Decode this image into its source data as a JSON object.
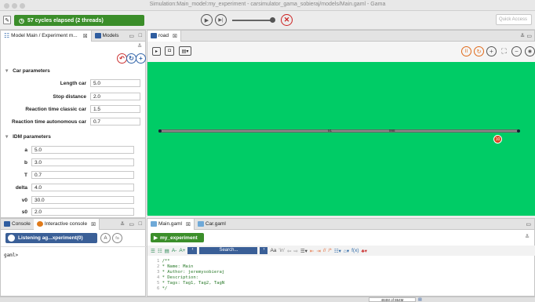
{
  "window": {
    "title": "Simulation:Main_model:my_experiment - carsimulator_gama_sobieraj/models/Main.gaml - Gama"
  },
  "toolbar": {
    "status": "57 cycles elapsed (2 threads)",
    "quick_access": "Quick Access"
  },
  "params_panel": {
    "tabs": [
      {
        "label": "Model Main / Experiment m..."
      },
      {
        "label": "Models"
      }
    ],
    "sections": {
      "car": "Car parameters",
      "idm": "IDM parameters"
    },
    "car_params": [
      {
        "label": "Length car",
        "value": "5.0"
      },
      {
        "label": "Stop distance",
        "value": "2.0"
      },
      {
        "label": "Reaction time classic car",
        "value": "1.5"
      },
      {
        "label": "Reaction time autonomous car",
        "value": "0.7"
      }
    ],
    "idm_params": [
      {
        "label": "a",
        "value": "5.0"
      },
      {
        "label": "b",
        "value": "3.0"
      },
      {
        "label": "T",
        "value": "0.7"
      },
      {
        "label": "delta",
        "value": "4.0"
      },
      {
        "label": "v0",
        "value": "30.0"
      },
      {
        "label": "s0",
        "value": "2.0"
      }
    ]
  },
  "display": {
    "tab": "road",
    "road_labels": [
      "91",
      "998"
    ],
    "car_marker": "10"
  },
  "console": {
    "tabs": [
      {
        "label": "Console"
      },
      {
        "label": "Interactive console"
      }
    ],
    "listening": "Listening ag...xperiment(0)",
    "btn_a": "A",
    "btn_fa": "fa",
    "prompt": "gaml>"
  },
  "editor": {
    "tabs": [
      {
        "label": "Main.gaml"
      },
      {
        "label": "Car.gaml"
      }
    ],
    "experiment_btn": "my_experiment",
    "search_placeholder": "Search...",
    "aa": "Aa",
    "in": "'in'",
    "comment": "//",
    "block": "/*",
    "fx": "f(x)",
    "code": [
      {
        "num": "1",
        "text": "/**"
      },
      {
        "num": "2",
        "text": "* Name: Main"
      },
      {
        "num": "3",
        "text": "* Author: jeremysobieraj"
      },
      {
        "num": "4",
        "text": "* Description:"
      },
      {
        "num": "5",
        "text": "* Tags: Tag1, Tag2, TagN"
      },
      {
        "num": "6",
        "text": "*/"
      }
    ]
  },
  "statusbar": {
    "memory": "484M of 864M"
  }
}
